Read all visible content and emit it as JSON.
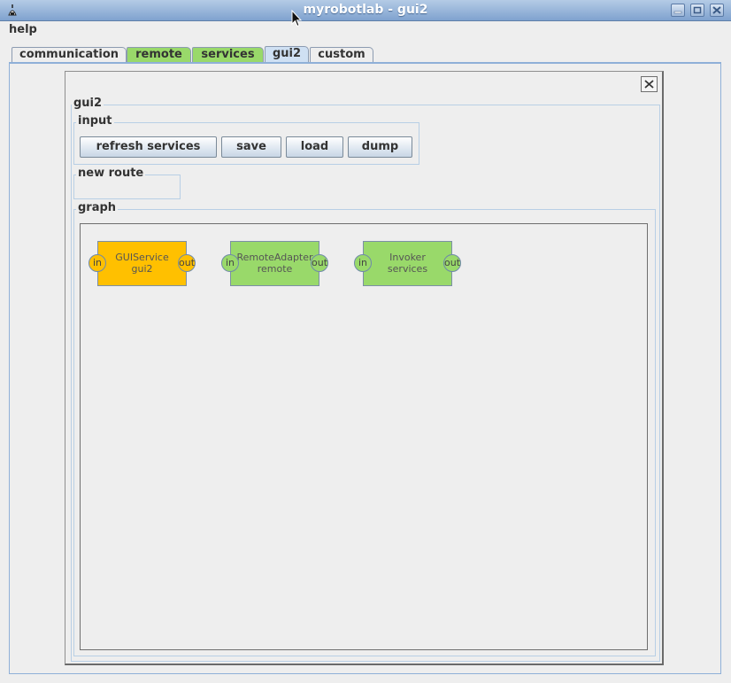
{
  "window": {
    "title": "myrobotlab - gui2"
  },
  "menu": {
    "items": [
      {
        "label": "help"
      }
    ]
  },
  "tabs": [
    {
      "label": "communication"
    },
    {
      "label": "remote"
    },
    {
      "label": "services"
    },
    {
      "label": "gui2"
    },
    {
      "label": "custom"
    }
  ],
  "colors": {
    "tab_active_green": "#99d96a",
    "tab_selected": "#cfe0f3",
    "node_gui": "#ffc000",
    "node_other": "#99d96a"
  },
  "panel": {
    "title": "gui2",
    "input_section": {
      "title": "input",
      "buttons": [
        {
          "label": "refresh services"
        },
        {
          "label": "save"
        },
        {
          "label": "load"
        },
        {
          "label": "dump"
        }
      ]
    },
    "new_route_section": {
      "title": "new route"
    },
    "graph_section": {
      "title": "graph",
      "nodes": [
        {
          "type": "GUIService",
          "name": "gui2",
          "in_label": "in",
          "out_label": "out",
          "color": "#ffc000"
        },
        {
          "type": "RemoteAdapter",
          "name": "remote",
          "in_label": "in",
          "out_label": "out",
          "color": "#99d96a"
        },
        {
          "type": "Invoker",
          "name": "services",
          "in_label": "in",
          "out_label": "out",
          "color": "#99d96a"
        }
      ]
    }
  }
}
